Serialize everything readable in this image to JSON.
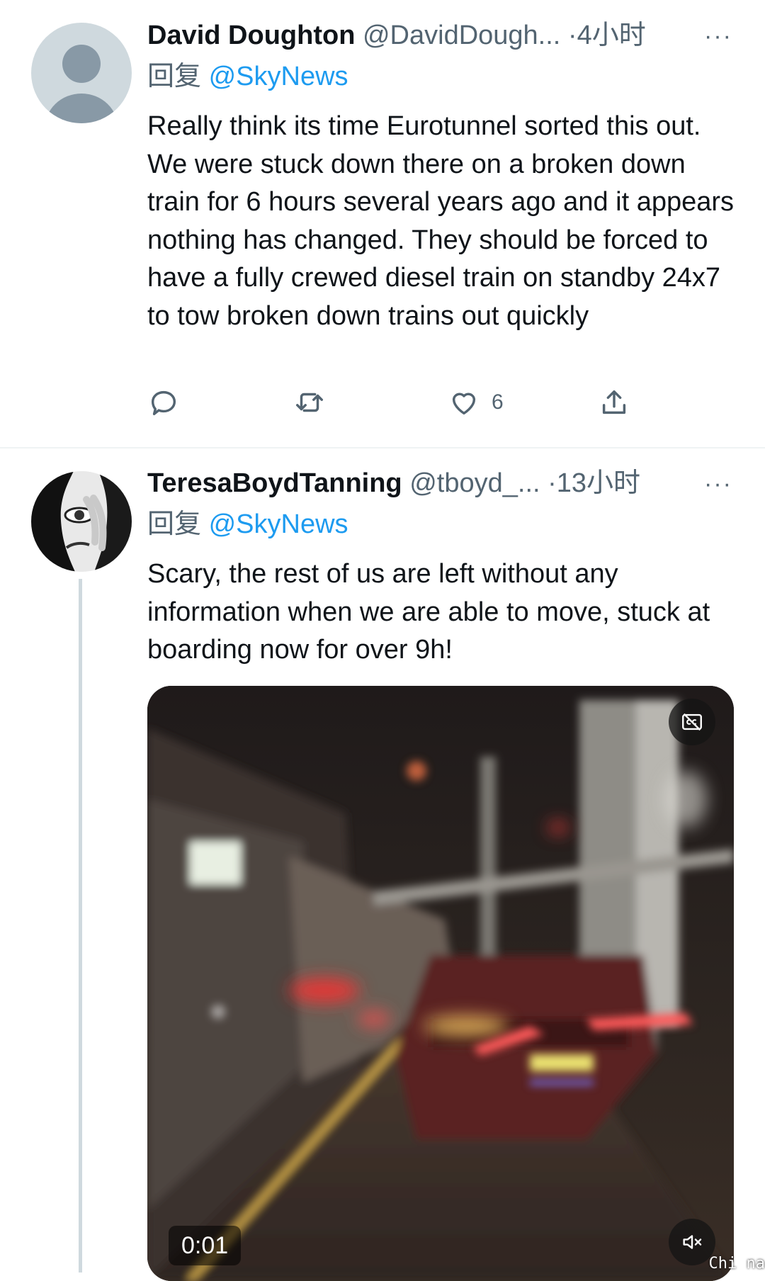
{
  "tweets": [
    {
      "name": "David Doughton",
      "handle": "@DavidDough...",
      "dot": "·",
      "time": "4小时",
      "reply_prefix": "回复",
      "reply_to": "@SkyNews",
      "text": "Really think its time Eurotunnel sorted this out. We were stuck down there on a broken down train for 6 hours several years ago and it appears nothing has changed. They should be forced to have  a fully crewed diesel train on standby 24x7 to tow broken down trains out quickly",
      "actions": {
        "reply_icon": "reply-icon",
        "retweet_icon": "retweet-icon",
        "like_icon": "heart-icon",
        "like_count": "6",
        "share_icon": "share-icon"
      }
    },
    {
      "name": "TeresaBoydTanning",
      "handle": "@tboyd_...",
      "dot": "·",
      "time": "13小时",
      "reply_prefix": "回复",
      "reply_to": "@SkyNews",
      "text": "Scary, the rest of us are left without any information when we are able to move, stuck at boarding now for over 9h!",
      "video": {
        "duration": "0:01",
        "cc_icon": "captions-off-icon",
        "mute_icon": "muted-speaker-icon"
      }
    }
  ],
  "more_icon": "more-options-icon",
  "more_label": "···",
  "watermark": "Chi na",
  "colors": {
    "link": "#1d9bf0",
    "secondary_text": "#536471",
    "primary_text": "#0f1419",
    "divider": "#eff3f4"
  }
}
